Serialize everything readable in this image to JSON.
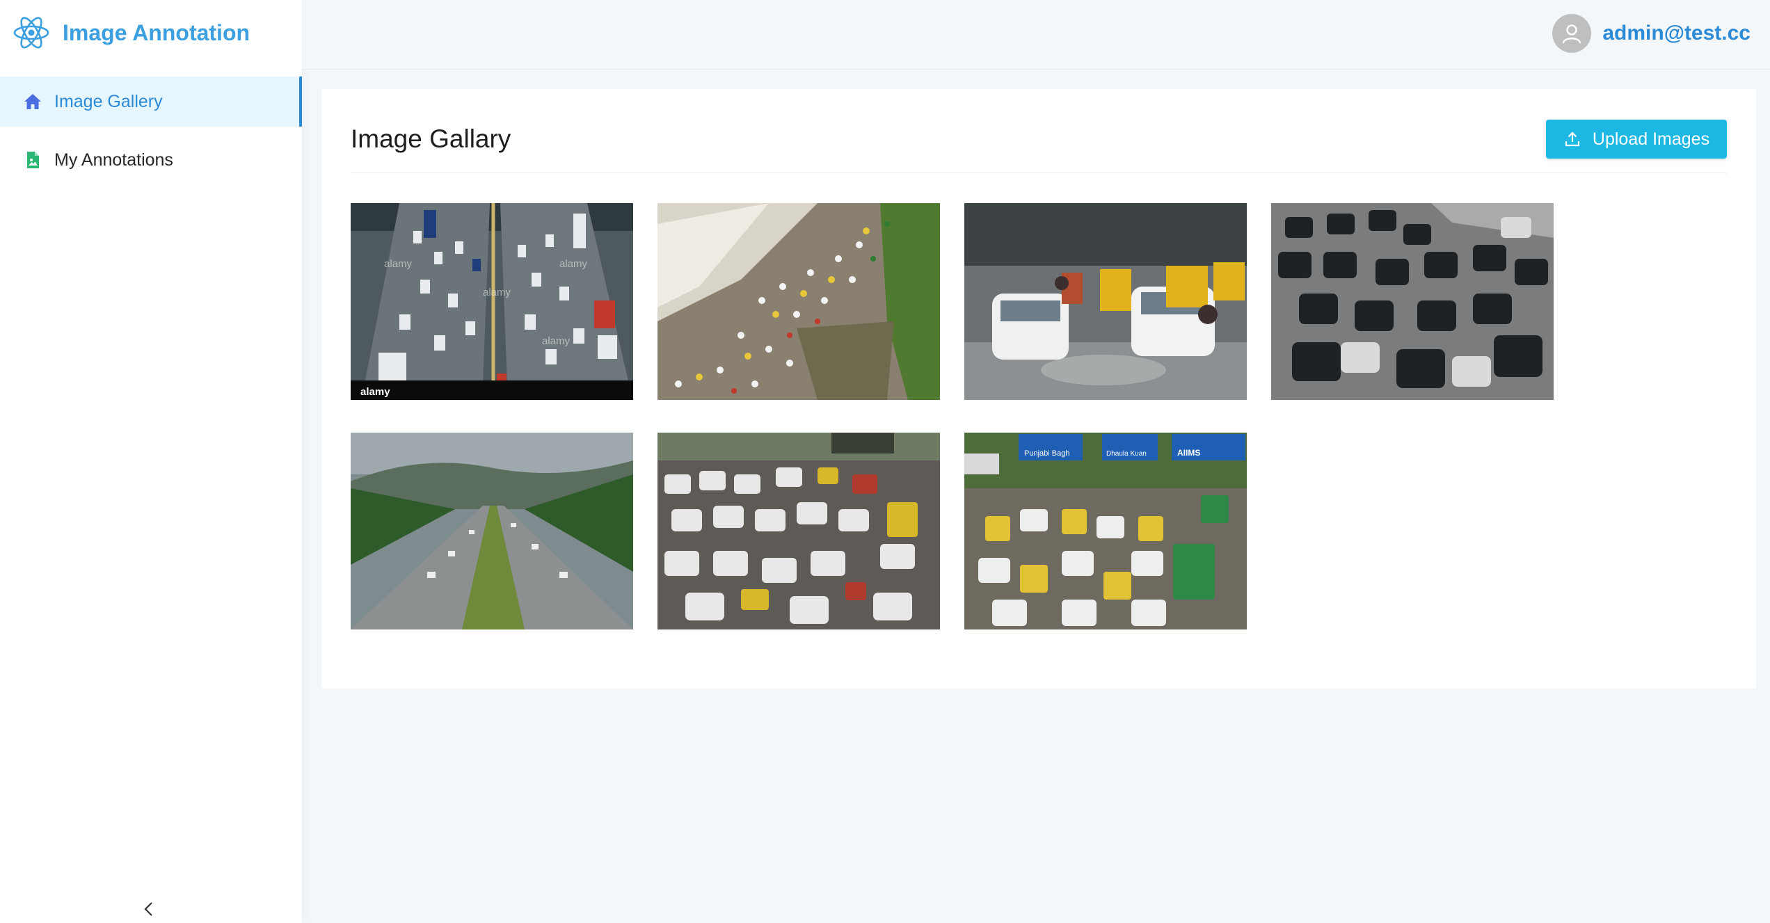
{
  "app": {
    "title": "Image Annotation",
    "logo_icon": "react-atom-icon",
    "accent_color": "#2b8ad6",
    "brand_color": "#3b9fe0"
  },
  "sidebar": {
    "items": [
      {
        "label": "Image Gallery",
        "icon": "home-icon",
        "active": true
      },
      {
        "label": "My Annotations",
        "icon": "document-icon",
        "active": false
      }
    ],
    "collapse_icon": "chevron-left-icon"
  },
  "header": {
    "user_email": "admin@test.cc",
    "avatar_icon": "user-icon"
  },
  "main": {
    "title": "Image Gallary",
    "upload_label": "Upload Images",
    "upload_icon": "upload-icon",
    "upload_color": "#1cb8e3",
    "images": [
      {
        "name": "highway-traffic-watermarked"
      },
      {
        "name": "roundabout-aerial-traffic"
      },
      {
        "name": "rainy-street-cars-rickshaws"
      },
      {
        "name": "multi-lane-car-traffic"
      },
      {
        "name": "green-expressway"
      },
      {
        "name": "dense-city-traffic-jam"
      },
      {
        "name": "traffic-under-sign-boards"
      }
    ]
  },
  "signs": {
    "punjabi_bagh": "Punjabi Bagh",
    "dhaula_kuan": "Dhaula Kuan",
    "aiims": "AIIMS",
    "watermark": "alamy"
  }
}
